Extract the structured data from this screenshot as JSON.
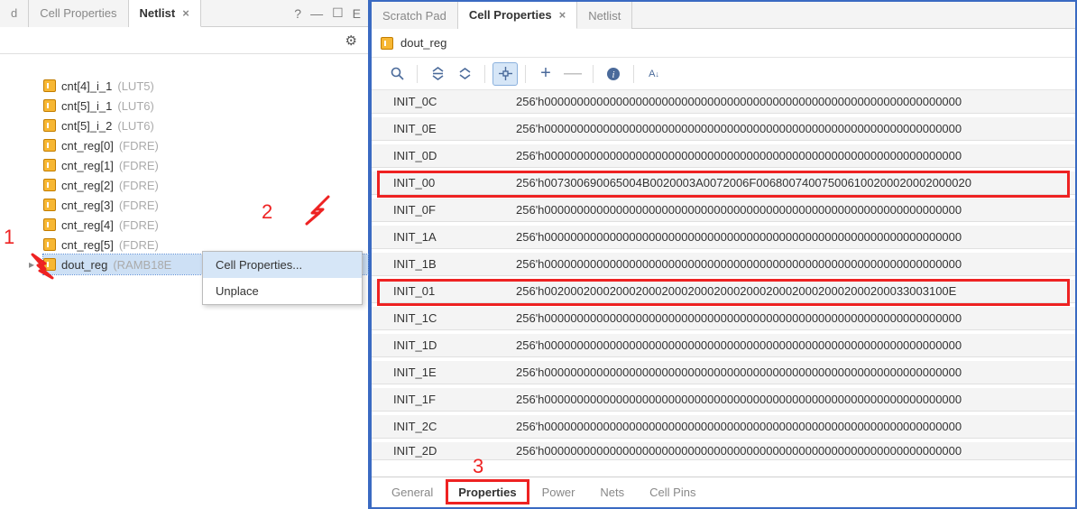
{
  "left_panel": {
    "tabs": [
      {
        "label": "d",
        "active": false,
        "truncated": true
      },
      {
        "label": "Cell Properties",
        "active": false
      },
      {
        "label": "Netlist",
        "active": true,
        "closable": true
      }
    ],
    "help_icon": "?",
    "minimize_icon": "—",
    "maximize_icon": "☐",
    "close_icon": "E",
    "gear_icon": "⚙",
    "tree_items": [
      {
        "name": "cnt[4]_i_1",
        "type": "(LUT5)"
      },
      {
        "name": "cnt[5]_i_1",
        "type": "(LUT6)"
      },
      {
        "name": "cnt[5]_i_2",
        "type": "(LUT6)"
      },
      {
        "name": "cnt_reg[0]",
        "type": "(FDRE)"
      },
      {
        "name": "cnt_reg[1]",
        "type": "(FDRE)"
      },
      {
        "name": "cnt_reg[2]",
        "type": "(FDRE)"
      },
      {
        "name": "cnt_reg[3]",
        "type": "(FDRE)"
      },
      {
        "name": "cnt_reg[4]",
        "type": "(FDRE)"
      },
      {
        "name": "cnt_reg[5]",
        "type": "(FDRE)"
      },
      {
        "name": "dout_reg",
        "type": "(RAMB18E",
        "selected": true,
        "chevron": true
      }
    ],
    "context_menu": {
      "items": [
        {
          "label": "Cell Properties...",
          "hover": true
        },
        {
          "label": "Unplace"
        }
      ]
    },
    "annotations": {
      "num1": "1",
      "num2": "2"
    }
  },
  "right_panel": {
    "tabs": [
      {
        "label": "Scratch Pad",
        "active": false
      },
      {
        "label": "Cell Properties",
        "active": true,
        "closable": true
      },
      {
        "label": "Netlist",
        "active": false
      }
    ],
    "cell_title": "dout_reg",
    "toolbar_icons": {
      "search": "Q",
      "collapse": "⇕",
      "expand": "⇕",
      "tree": "⊹",
      "plus": "+",
      "minus": "—",
      "info": "i",
      "sort": "A↓z"
    },
    "properties": [
      {
        "key": "INIT_0C",
        "val": "256'h0000000000000000000000000000000000000000000000000000000000000000"
      },
      {
        "key": "INIT_0E",
        "val": "256'h0000000000000000000000000000000000000000000000000000000000000000"
      },
      {
        "key": "INIT_0D",
        "val": "256'h0000000000000000000000000000000000000000000000000000000000000000"
      },
      {
        "key": "INIT_00",
        "val": "256'h007300690065004B0020003A0072006F006800740075006100200020002000020",
        "highlight": true
      },
      {
        "key": "INIT_0F",
        "val": "256'h0000000000000000000000000000000000000000000000000000000000000000"
      },
      {
        "key": "INIT_1A",
        "val": "256'h0000000000000000000000000000000000000000000000000000000000000000"
      },
      {
        "key": "INIT_1B",
        "val": "256'h0000000000000000000000000000000000000000000000000000000000000000"
      },
      {
        "key": "INIT_01",
        "val": "256'h00200020002000200020002000200020002000200020002000200033003100E",
        "highlight": true
      },
      {
        "key": "INIT_1C",
        "val": "256'h0000000000000000000000000000000000000000000000000000000000000000"
      },
      {
        "key": "INIT_1D",
        "val": "256'h0000000000000000000000000000000000000000000000000000000000000000"
      },
      {
        "key": "INIT_1E",
        "val": "256'h0000000000000000000000000000000000000000000000000000000000000000"
      },
      {
        "key": "INIT_1F",
        "val": "256'h0000000000000000000000000000000000000000000000000000000000000000"
      },
      {
        "key": "INIT_2C",
        "val": "256'h0000000000000000000000000000000000000000000000000000000000000000"
      },
      {
        "key": "INIT_2D",
        "val": "256'h0000000000000000000000000000000000000000000000000000000000000000",
        "cut": true
      }
    ],
    "bottom_tabs": [
      {
        "label": "General"
      },
      {
        "label": "Properties",
        "active": true,
        "highlight": true
      },
      {
        "label": "Power"
      },
      {
        "label": "Nets"
      },
      {
        "label": "Cell Pins"
      }
    ],
    "annotations": {
      "num3": "3"
    }
  }
}
